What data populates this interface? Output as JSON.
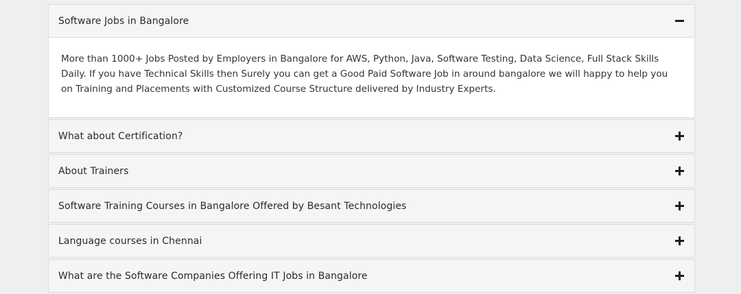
{
  "accordion": {
    "items": [
      {
        "title": "Software Jobs in Bangalore",
        "expanded": true,
        "icon": "minus-icon",
        "body": "More than 1000+ Jobs Posted by Employers in Bangalore for AWS, Python, Java, Software Testing, Data Science, Full Stack Skills Daily. If you have Technical Skills then Surely you can get a Good Paid Software Job in around bangalore we will happy to help you on Training and Placements with Customized Course Structure delivered by Industry Experts."
      },
      {
        "title": "What about Certification?",
        "expanded": false,
        "icon": "plus-icon"
      },
      {
        "title": "About Trainers",
        "expanded": false,
        "icon": "plus-icon"
      },
      {
        "title": "Software Training Courses in Bangalore Offered by Besant Technologies",
        "expanded": false,
        "icon": "plus-icon"
      },
      {
        "title": "Language courses in Chennai",
        "expanded": false,
        "icon": "plus-icon"
      },
      {
        "title": "What are the Software Companies Offering IT Jobs in Bangalore",
        "expanded": false,
        "icon": "plus-icon"
      }
    ]
  },
  "colors": {
    "page_background": "#efefef",
    "header_background": "#f5f5f5",
    "body_background": "#ffffff",
    "border": "#dcdcdc",
    "text": "#2a2a2a"
  }
}
